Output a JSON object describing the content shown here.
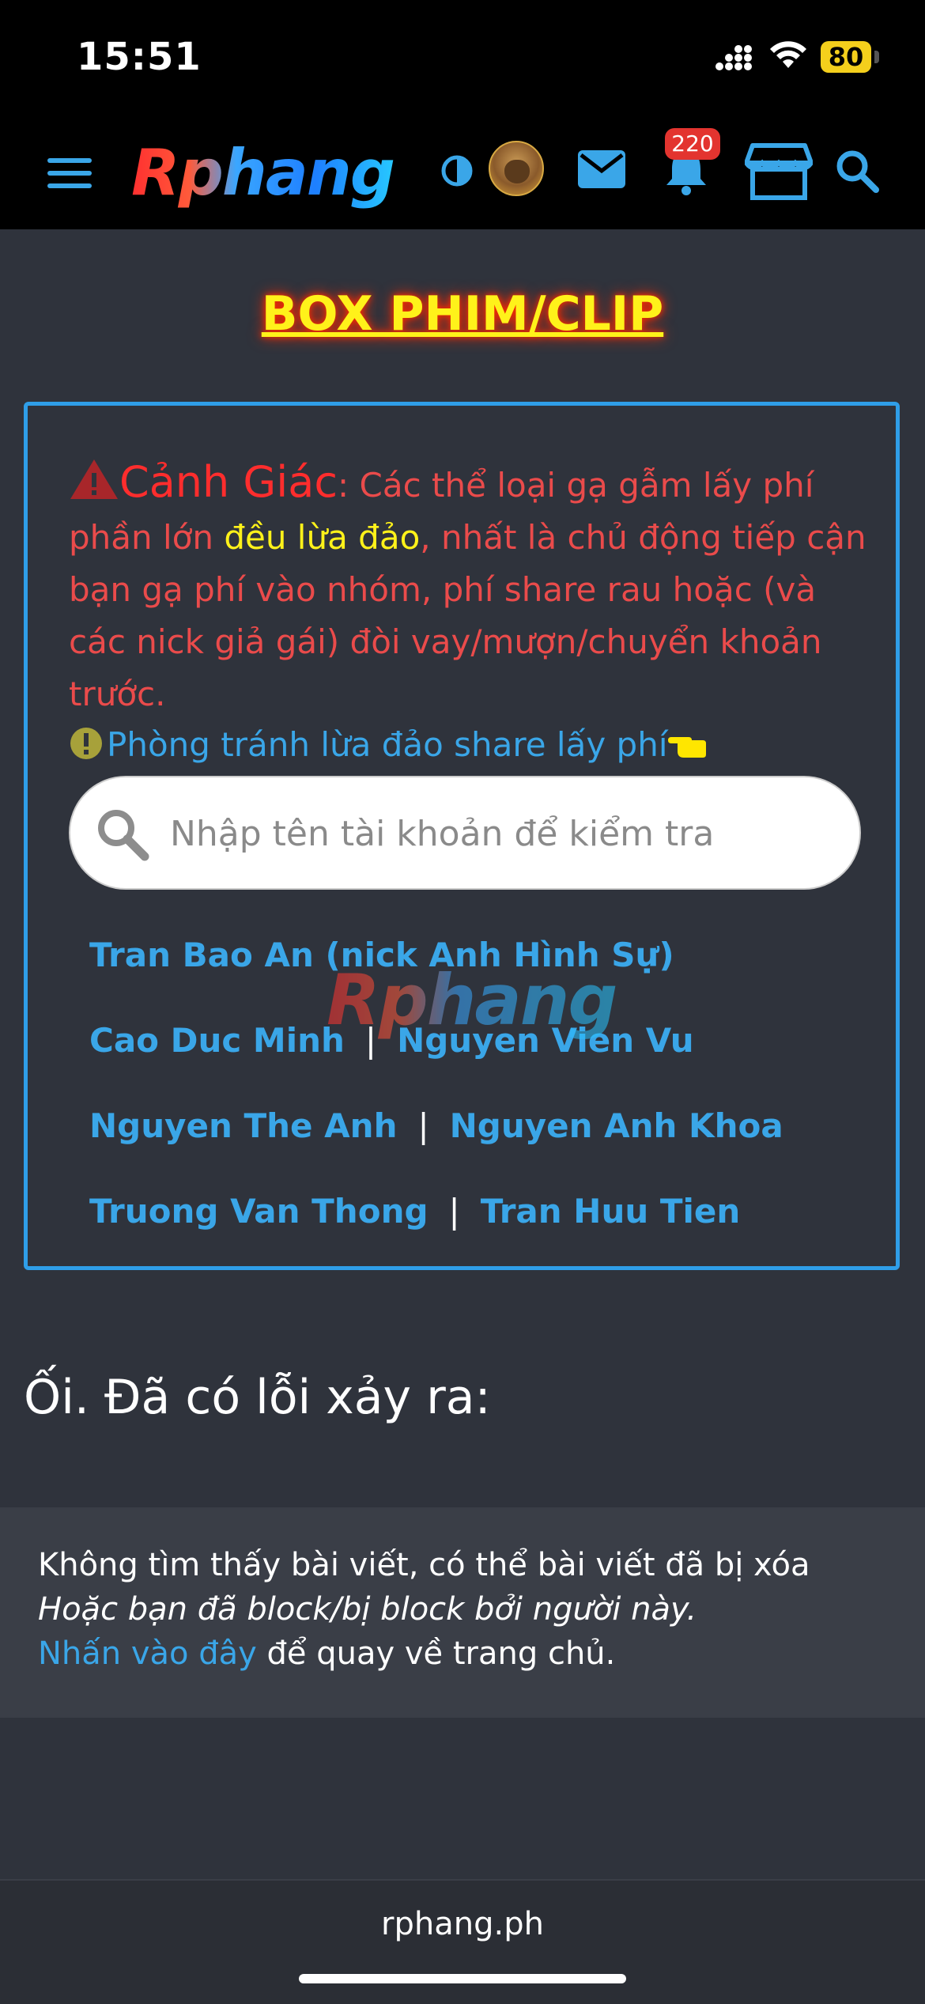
{
  "status_bar": {
    "time": "15:51",
    "battery": "80"
  },
  "header": {
    "logo": "Rphang",
    "notification_count": "220"
  },
  "section_title": "BOX PHIM/CLIP",
  "warning": {
    "heading": "Cảnh Giác",
    "text_part1": ": Các thể loại gạ gẫm lấy phí phần lớn ",
    "highlight": "đều lừa đảo",
    "text_part2": ", nhất là chủ động tiếp cận bạn gạ phí vào nhóm, phí share rau hoặc (và các nick giả gái) đòi vay/mượn/chuyển khoản trước.",
    "tip": "Phòng tránh lừa đảo share lấy phí"
  },
  "search": {
    "placeholder": "Nhập tên tài khoản để kiểm tra"
  },
  "scam_accounts": [
    "Tran Bao An (nick Anh Hình Sự)",
    "Cao Duc Minh",
    "Nguyen Vien Vu",
    "Nguyen The Anh",
    "Nguyen Anh Khoa",
    "Truong Van Thong",
    "Tran Huu Tien"
  ],
  "separator": "|",
  "watermark": "Rphang",
  "error": {
    "title": "Ối. Đã có lỗi xảy ra:",
    "line1": "Không tìm thấy bài viết, có thể bài viết đã bị xóa",
    "line2": "Hoặc bạn đã block/bị block bởi người này.",
    "link": "Nhấn vào đây",
    "line3_rest": " để quay về trang chủ."
  },
  "footer": {
    "domain": "rphang.ph"
  },
  "colors": {
    "accent": "#3aa6e8",
    "warning_red": "#ea4b4b",
    "highlight_yellow": "#fff21a",
    "title_yellow": "#fff21a"
  },
  "icons": [
    "menu-icon",
    "contrast-icon",
    "mail-icon",
    "bell-icon",
    "store-icon",
    "search-icon",
    "warning-triangle-icon",
    "exclamation-icon",
    "pointing-hand-icon"
  ]
}
